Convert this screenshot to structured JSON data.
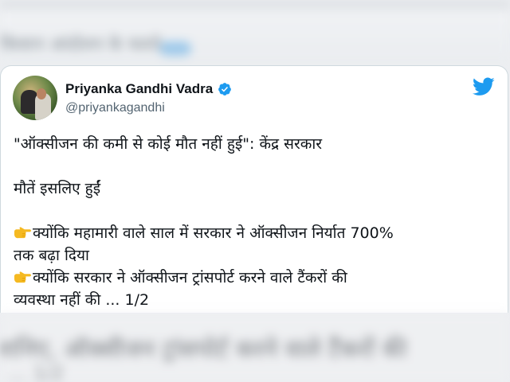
{
  "background": {
    "top_text": "किसान आंदोलन के चलते",
    "bottom_text": "जानिए, ऑक्सीजन ट्रांसपोर्ट करने वाले टैंकरों की",
    "bottom_text_2": "… 1/2"
  },
  "tweet": {
    "author_name": "Priyanka Gandhi Vadra",
    "author_handle": "@priyankagandhi",
    "line1": "\"ऑक्सीजन की कमी से कोई मौत नहीं हुई\": केंद्र सरकार",
    "line2": "मौतें इसलिए हुईं",
    "line3": "क्योंकि महामारी वाले साल में सरकार ने ऑक्सीजन निर्यात 700%",
    "line4": "तक बढ़ा दिया",
    "line5": "क्योंकि सरकार ने ऑक्सीजन ट्रांसपोर्ट करने वाले टैंकरों की",
    "line6": "व्यवस्था नहीं की ... 1/2"
  },
  "colors": {
    "twitter_blue": "#1d9bf0",
    "text_primary": "#0f1419",
    "text_secondary": "#536471",
    "pointing_hand": "#f5b921"
  },
  "icons": {
    "verified": "verified-badge-icon",
    "brand": "twitter-bird-icon",
    "bullet": "pointing-right-hand-icon"
  }
}
